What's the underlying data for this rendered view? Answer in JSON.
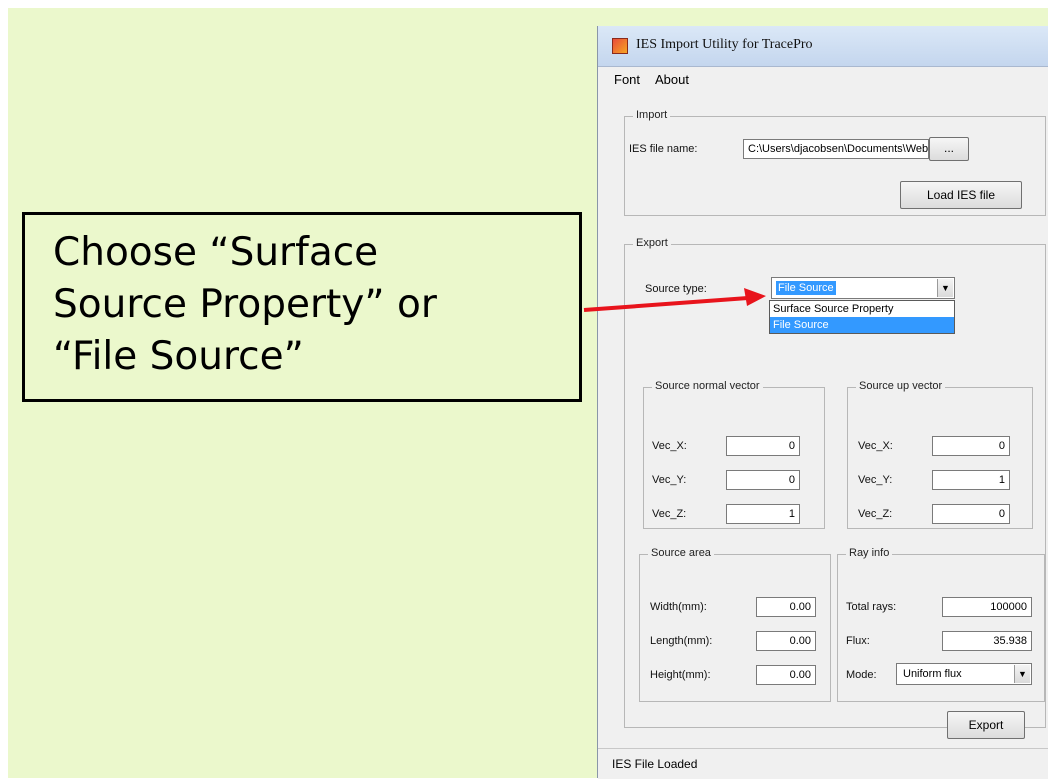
{
  "callout": {
    "lines": [
      "Choose “Surface",
      "Source Property” or",
      "“File Source”"
    ]
  },
  "window": {
    "title": "IES Import Utility for TracePro",
    "menu": [
      "Font",
      "About"
    ],
    "import": {
      "group_label": "Import",
      "ies_file_label": "IES file name:",
      "ies_file_value": "C:\\Users\\djacobsen\\Documents\\Webinar",
      "browse_label": "...",
      "load_button": "Load IES file"
    },
    "export": {
      "group_label": "Export",
      "source_type_label": "Source type:",
      "source_type_value": "File Source",
      "source_type_options": [
        "Surface Source Property",
        "File Source"
      ],
      "normal_vector": {
        "label": "Source normal vector",
        "vec_x_label": "Vec_X:",
        "vec_x": "0",
        "vec_y_label": "Vec_Y:",
        "vec_y": "0",
        "vec_z_label": "Vec_Z:",
        "vec_z": "1"
      },
      "up_vector": {
        "label": "Source up vector",
        "vec_x_label": "Vec_X:",
        "vec_x": "0",
        "vec_y_label": "Vec_Y:",
        "vec_y": "1",
        "vec_z_label": "Vec_Z:",
        "vec_z": "0"
      },
      "source_area": {
        "label": "Source area",
        "width_label": "Width(mm):",
        "width": "0.00",
        "length_label": "Length(mm):",
        "length": "0.00",
        "height_label": "Height(mm):",
        "height": "0.00"
      },
      "ray_info": {
        "label": "Ray info",
        "total_rays_label": "Total rays:",
        "total_rays": "100000",
        "flux_label": "Flux:",
        "flux": "35.938",
        "mode_label": "Mode:",
        "mode_value": "Uniform flux"
      },
      "export_button": "Export"
    },
    "status": "IES File Loaded"
  },
  "colors": {
    "arrow": "#e8141c",
    "slide_bg": "#ebf8cc",
    "selection": "#3399ff"
  }
}
